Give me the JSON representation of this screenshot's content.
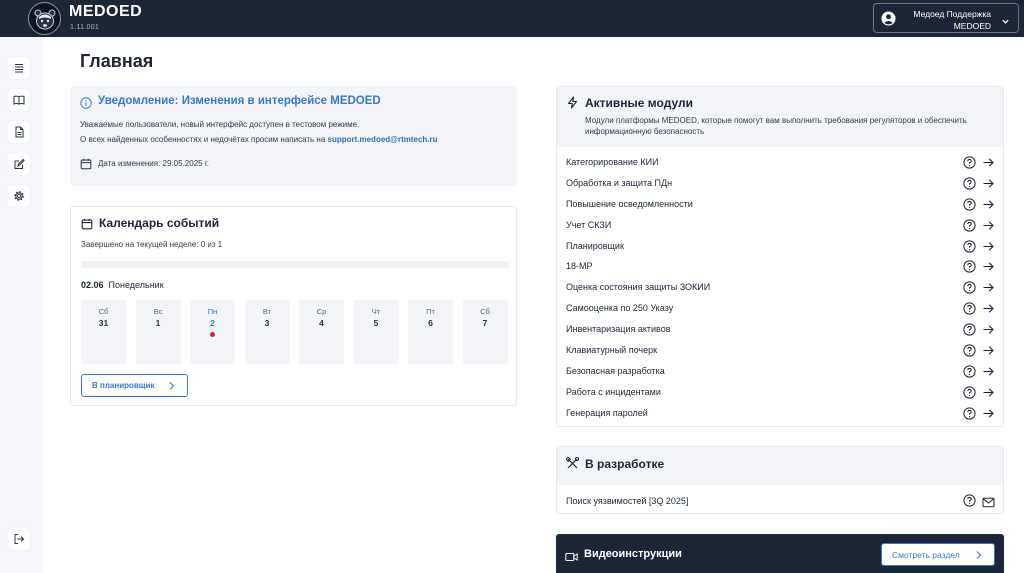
{
  "app": {
    "name": "MEDOED",
    "version": "1.11.001",
    "user": {
      "name": "Медоед Поддержка",
      "org": "MEDOED"
    }
  },
  "sidebar": {
    "items": [
      {
        "icon": "list-icon"
      },
      {
        "icon": "book-icon"
      },
      {
        "icon": "document-icon"
      },
      {
        "icon": "edit-icon"
      },
      {
        "icon": "gear-icon"
      }
    ],
    "bottom_icon": "logout-icon"
  },
  "page": {
    "title": "Главная"
  },
  "notification": {
    "title": "Уведомление: Изменения в интерфейсе MEDOED",
    "line1": "Уважаемые пользователи, новый интерфейс доступен в тестовом режиме.",
    "line2_prefix": "О всех найденных особенностях и недочётах просим написать на ",
    "email": "support.medoed@rtmtech.ru",
    "date": "Дата изменения: 29.05.2025 г."
  },
  "calendar": {
    "title": "Календарь событий",
    "completed": "Завершено на текущей неделе: 0 из 1",
    "progress": 0,
    "current_date": "02.06",
    "current_weekday": "Понедельник",
    "days": [
      {
        "name": "Сб",
        "num": "31",
        "today": false,
        "event": false
      },
      {
        "name": "Вс",
        "num": "1",
        "today": false,
        "event": false
      },
      {
        "name": "Пн",
        "num": "2",
        "today": true,
        "event": true
      },
      {
        "name": "Вт",
        "num": "3",
        "today": false,
        "event": false
      },
      {
        "name": "Ср",
        "num": "4",
        "today": false,
        "event": false
      },
      {
        "name": "Чт",
        "num": "5",
        "today": false,
        "event": false
      },
      {
        "name": "Пт",
        "num": "6",
        "today": false,
        "event": false
      },
      {
        "name": "Сб",
        "num": "7",
        "today": false,
        "event": false
      }
    ],
    "planner_button": "В планировщик"
  },
  "modules": {
    "title": "Активные модули",
    "description": "Модули платформы MEDOED, которые помогут вам выполнить требования регуляторов и обеспечить информационную безопасность",
    "items": [
      "Категорирование КИИ",
      "Обработка и защита ПДн",
      "Повышение осведомленности",
      "Учет СКЗИ",
      "Планировщик",
      "18-МР",
      "Оценка состояния защиты ЗОКИИ",
      "Самооценка по 250 Указу",
      "Инвентаризация активов",
      "Клавиатурный почерк",
      "Безопасная разработка",
      "Работа с инцидентами",
      "Генерация паролей"
    ]
  },
  "in_development": {
    "title": "В разработке",
    "items": [
      "Поиск уязвимостей [3Q 2025]"
    ]
  },
  "video": {
    "title": "Видеоинструкции",
    "button": "Смотреть раздел"
  },
  "colors": {
    "topbar": "#1d2636",
    "accent": "#3a78c3",
    "panel": "#f2f4f7",
    "event_dot": "#d12b3a"
  }
}
